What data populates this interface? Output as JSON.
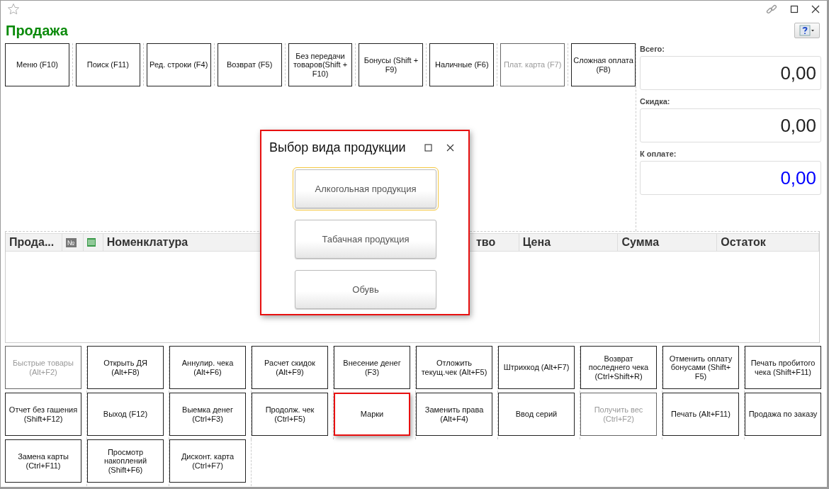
{
  "window": {
    "title": "Продажа"
  },
  "top_buttons": [
    {
      "label": "Меню (F10)",
      "disabled": false
    },
    {
      "label": "Поиск (F11)",
      "disabled": false
    },
    {
      "label": "Ред. строки (F4)",
      "disabled": false
    },
    {
      "label": "Возврат (F5)",
      "disabled": false
    },
    {
      "label": "Без передачи товаров(Shift + F10)",
      "disabled": false
    },
    {
      "label": "Бонусы (Shift + F9)",
      "disabled": false
    },
    {
      "label": "Наличные (F6)",
      "disabled": false
    },
    {
      "label": "Плат. карта (F7)",
      "disabled": true
    },
    {
      "label": "Сложная оплата (F8)",
      "disabled": false
    }
  ],
  "totals": [
    {
      "label": "Всего:",
      "value": "0,00",
      "accent": false
    },
    {
      "label": "Скидка:",
      "value": "0,00",
      "accent": false
    },
    {
      "label": "К оплате:",
      "value": "0,00",
      "accent": true
    }
  ],
  "table": {
    "columns": [
      {
        "kind": "text",
        "label": "Прода..."
      },
      {
        "kind": "badge",
        "label": "№"
      },
      {
        "kind": "icon"
      },
      {
        "kind": "text",
        "label": "Номенклатура"
      },
      {
        "kind": "text",
        "label": "тво"
      },
      {
        "kind": "text",
        "label": "Цена"
      },
      {
        "kind": "text",
        "label": "Сумма"
      },
      {
        "kind": "text",
        "label": "Остаток"
      }
    ]
  },
  "bottom_buttons": [
    {
      "label": "Быстрые товары (Alt+F2)",
      "disabled": true,
      "highlighted": false
    },
    {
      "label": "Открыть ДЯ (Alt+F8)",
      "disabled": false,
      "highlighted": false
    },
    {
      "label": "Аннулир. чека (Alt+F6)",
      "disabled": false,
      "highlighted": false
    },
    {
      "label": "Расчет скидок (Alt+F9)",
      "disabled": false,
      "highlighted": false
    },
    {
      "label": "Внесение денег (F3)",
      "disabled": false,
      "highlighted": false
    },
    {
      "label": "Отложить текущ.чек (Alt+F5)",
      "disabled": false,
      "highlighted": false
    },
    {
      "label": "Штрихкод (Alt+F7)",
      "disabled": false,
      "highlighted": false
    },
    {
      "label": "Возврат последнего чека (Ctrl+Shift+R)",
      "disabled": false,
      "highlighted": false
    },
    {
      "label": "Отменить оплату бонусами (Shift+ F5)",
      "disabled": false,
      "highlighted": false
    },
    {
      "label": "Печать пробитого чека (Shift+F11)",
      "disabled": false,
      "highlighted": false
    },
    {
      "label": "Отчет без гашения (Shift+F12)",
      "disabled": false,
      "highlighted": false
    },
    {
      "label": "Выход (F12)",
      "disabled": false,
      "highlighted": false
    },
    {
      "label": "Выемка денег (Ctrl+F3)",
      "disabled": false,
      "highlighted": false
    },
    {
      "label": "Продолж. чек (Ctrl+F5)",
      "disabled": false,
      "highlighted": false
    },
    {
      "label": "Марки",
      "disabled": false,
      "highlighted": true
    },
    {
      "label": "Заменить права (Alt+F4)",
      "disabled": false,
      "highlighted": false
    },
    {
      "label": "Ввод серий",
      "disabled": false,
      "highlighted": false
    },
    {
      "label": "Получить вес (Ctrl+F2)",
      "disabled": true,
      "highlighted": false
    },
    {
      "label": "Печать (Alt+F11)",
      "disabled": false,
      "highlighted": false
    },
    {
      "label": "Продажа по заказу",
      "disabled": false,
      "highlighted": false
    },
    {
      "label": "Замена карты (Ctrl+F11)",
      "disabled": false,
      "highlighted": false
    },
    {
      "label": "Просмотр накоплений (Shift+F6)",
      "disabled": false,
      "highlighted": false
    },
    {
      "label": "Дисконт. карта (Ctrl+F7)",
      "disabled": false,
      "highlighted": false
    }
  ],
  "dialog": {
    "title": "Выбор вида продукции",
    "highlighted": true,
    "options": [
      {
        "label": "Алкогольная продукция",
        "focused": true
      },
      {
        "label": "Табачная продукция",
        "focused": false
      },
      {
        "label": "Обувь",
        "focused": false
      }
    ]
  }
}
